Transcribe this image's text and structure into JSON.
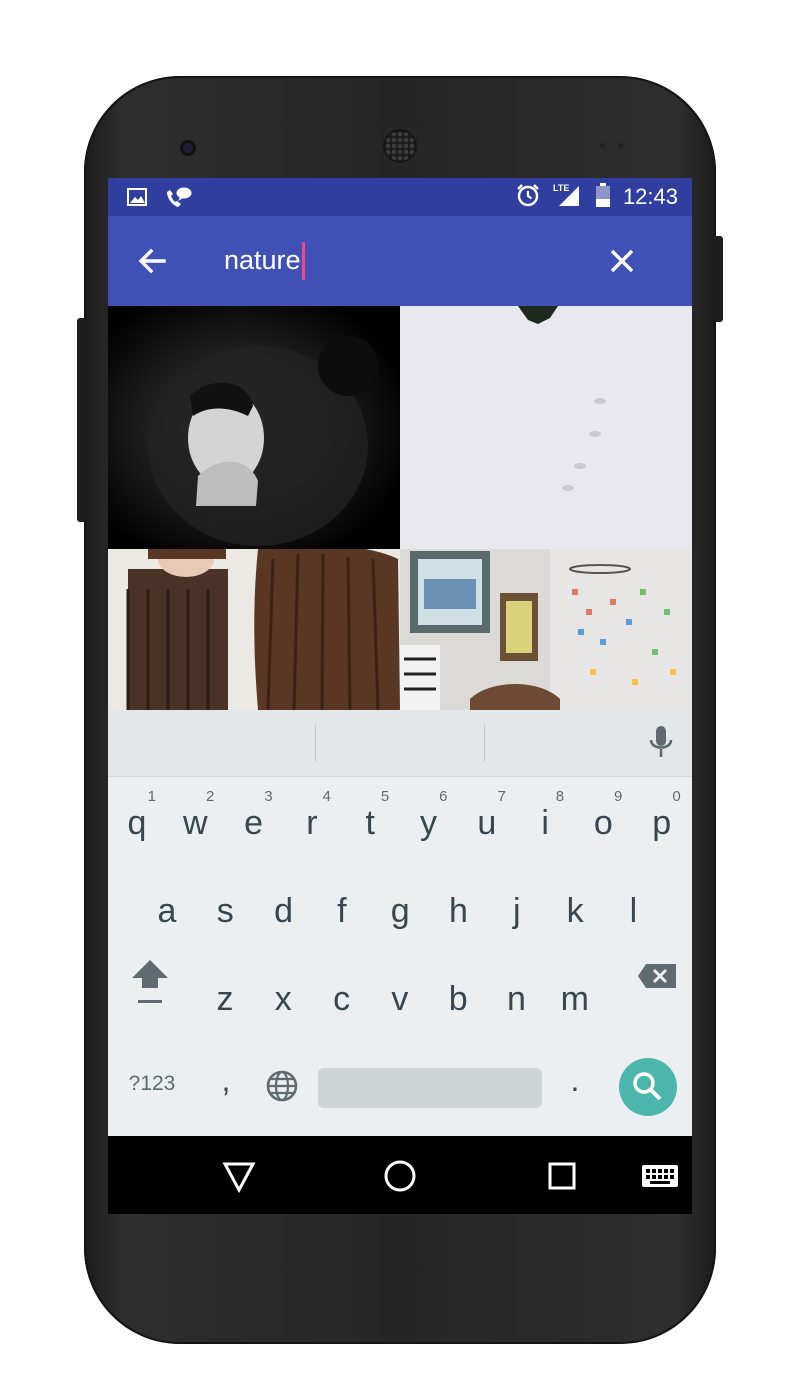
{
  "status_bar": {
    "time": "12:43",
    "left_icons": [
      "image-icon",
      "chat-call-icon"
    ],
    "right_icons": [
      "alarm-icon",
      "lte-signal-icon",
      "battery-icon"
    ],
    "network": "LTE"
  },
  "toolbar": {
    "search_value": "nature",
    "back_icon": "arrow-back-icon",
    "clear_icon": "close-icon",
    "caret_color": "#ff4081"
  },
  "colors": {
    "status_bar": "#303f9f",
    "toolbar": "#3f51b5",
    "search_key": "#4db6ac",
    "keyboard_bg": "#eceff1",
    "key_text": "#37474f"
  },
  "results": [
    {
      "subject": "black and white portrait"
    },
    {
      "subject": "snow with footprints"
    },
    {
      "subject": "long brown hair extension"
    },
    {
      "subject": "room with framed pictures and paper cranes"
    }
  ],
  "keyboard": {
    "row1": [
      {
        "key": "q",
        "hint": "1"
      },
      {
        "key": "w",
        "hint": "2"
      },
      {
        "key": "e",
        "hint": "3"
      },
      {
        "key": "r",
        "hint": "4"
      },
      {
        "key": "t",
        "hint": "5"
      },
      {
        "key": "y",
        "hint": "6"
      },
      {
        "key": "u",
        "hint": "7"
      },
      {
        "key": "i",
        "hint": "8"
      },
      {
        "key": "o",
        "hint": "9"
      },
      {
        "key": "p",
        "hint": "0"
      }
    ],
    "row2": [
      "a",
      "s",
      "d",
      "f",
      "g",
      "h",
      "j",
      "k",
      "l"
    ],
    "row3": [
      "z",
      "x",
      "c",
      "v",
      "b",
      "n",
      "m"
    ],
    "symbols_key": "?123",
    "comma_key": ",",
    "period_key": ".",
    "globe_icon": "globe-icon",
    "shift_icon": "shift-icon",
    "backspace_icon": "backspace-icon",
    "mic_icon": "mic-icon",
    "search_icon": "search-icon"
  },
  "nav_bar": {
    "icons": [
      "back-triangle-icon",
      "home-circle-icon",
      "recents-square-icon",
      "keyboard-icon"
    ]
  }
}
